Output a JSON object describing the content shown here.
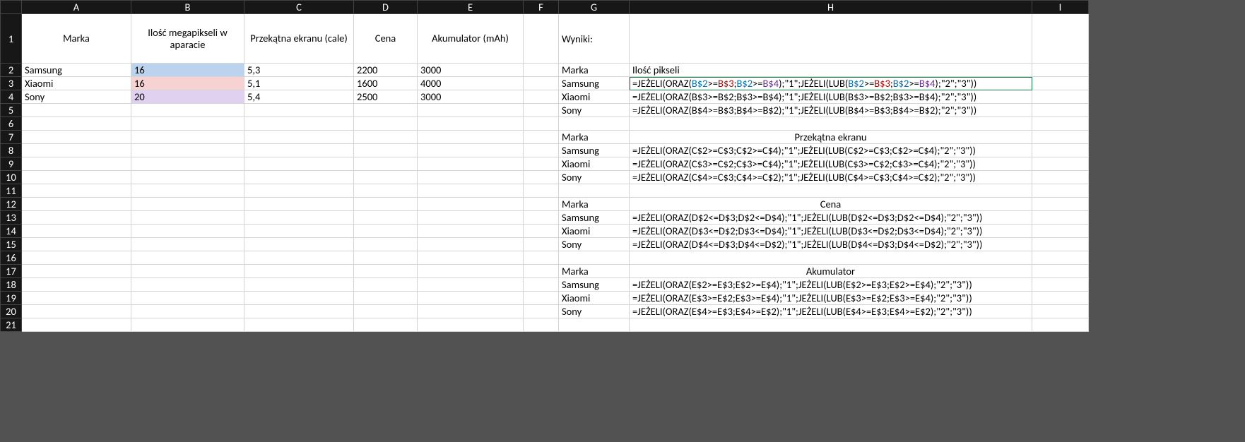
{
  "columns": [
    "A",
    "B",
    "C",
    "D",
    "E",
    "F",
    "G",
    "H",
    "I"
  ],
  "rowCount": 21,
  "headers": {
    "A": "Marka",
    "B": "Ilość megapikseli w aparacie",
    "C": "Przekątna ekranu (cale)",
    "D": "Cena",
    "E": "Akumulator (mAh)"
  },
  "dataRows": [
    {
      "A": "Samsung",
      "B": "16",
      "C": "5,3",
      "D": "2200",
      "E": "3000"
    },
    {
      "A": "Xiaomi",
      "B": "16",
      "C": "5,1",
      "D": "1600",
      "E": "4000"
    },
    {
      "A": "Sony",
      "B": "20",
      "C": "5,4",
      "D": "2500",
      "E": "3000"
    }
  ],
  "g": {
    "r1": "Wyniki:",
    "r2": "Marka",
    "r3": "Samsung",
    "r4": "Xiaomi",
    "r5": "Sony",
    "r7": "Marka",
    "r8": "Samsung",
    "r9": "Xiaomi",
    "r10": "Sony",
    "r12": "Marka",
    "r13": "Samsung",
    "r14": "Xiaomi",
    "r15": "Sony",
    "r17": "Marka",
    "r18": "Samsung",
    "r19": "Xiaomi",
    "r20": "Sony"
  },
  "h": {
    "r2": "Ilość pikseli",
    "r3_tokens": [
      {
        "t": "=JEŻELI(ORAZ("
      },
      {
        "t": "B$2",
        "c": "c-blue"
      },
      {
        "t": ">="
      },
      {
        "t": "B$3",
        "c": "c-red"
      },
      {
        "t": ";"
      },
      {
        "t": "B$2",
        "c": "c-blue"
      },
      {
        "t": ">="
      },
      {
        "t": "B$4",
        "c": "c-purple"
      },
      {
        "t": ");\"1\";JEŻELI(LUB("
      },
      {
        "t": "B$2",
        "c": "c-blue"
      },
      {
        "t": ">="
      },
      {
        "t": "B$3",
        "c": "c-red"
      },
      {
        "t": ";"
      },
      {
        "t": "B$2",
        "c": "c-blue"
      },
      {
        "t": ">="
      },
      {
        "t": "B$4",
        "c": "c-purple"
      },
      {
        "t": ");\"2\";\"3\"))"
      }
    ],
    "r4": "=JEŻELI(ORAZ(B$3>=B$2;B$3>=B$4);\"1\";JEŻELI(LUB(B$3>=B$2;B$3>=B$4);\"2\";\"3\"))",
    "r5": "=JEŻELI(ORAZ(B$4>=B$3;B$4>=B$2);\"1\";JEŻELI(LUB(B$4>=B$3;B$4>=B$2);\"2\";\"3\"))",
    "r7": "Przekątna ekranu",
    "r8": "=JEŻELI(ORAZ(C$2>=C$3;C$2>=C$4);\"1\";JEŻELI(LUB(C$2>=C$3;C$2>=C$4);\"2\";\"3\"))",
    "r9": "=JEŻELI(ORAZ(C$3>=C$2;C$3>=C$4);\"1\";JEŻELI(LUB(C$3>=C$2;C$3>=C$4);\"2\";\"3\"))",
    "r10": "=JEŻELI(ORAZ(C$4>=C$3;C$4>=C$2);\"1\";JEŻELI(LUB(C$4>=C$3;C$4>=C$2);\"2\";\"3\"))",
    "r12": "Cena",
    "r13": "=JEŻELI(ORAZ(D$2<=D$3;D$2<=D$4);\"1\";JEŻELI(LUB(D$2<=D$3;D$2<=D$4);\"2\";\"3\"))",
    "r14": "=JEŻELI(ORAZ(D$3<=D$2;D$3<=D$4);\"1\";JEŻELI(LUB(D$3<=D$2;D$3<=D$4);\"2\";\"3\"))",
    "r15": "=JEŻELI(ORAZ(D$4<=D$3;D$4<=D$2);\"1\";JEŻELI(LUB(D$4<=D$3;D$4<=D$2);\"2\";\"3\"))",
    "r17": "Akumulator",
    "r18": "=JEŻELI(ORAZ(E$2>=E$3;E$2>=E$4);\"1\";JEŻELI(LUB(E$2>=E$3;E$2>=E$4);\"2\";\"3\"))",
    "r19": "=JEŻELI(ORAZ(E$3>=E$2;E$3>=E$4);\"1\";JEŻELI(LUB(E$3>=E$2;E$3>=E$4);\"2\";\"3\"))",
    "r20": "=JEŻELI(ORAZ(E$4>=E$3;E$4>=E$2);\"1\";JEŻELI(LUB(E$4>=E$3;E$4>=E$2);\"2\";\"3\"))"
  }
}
